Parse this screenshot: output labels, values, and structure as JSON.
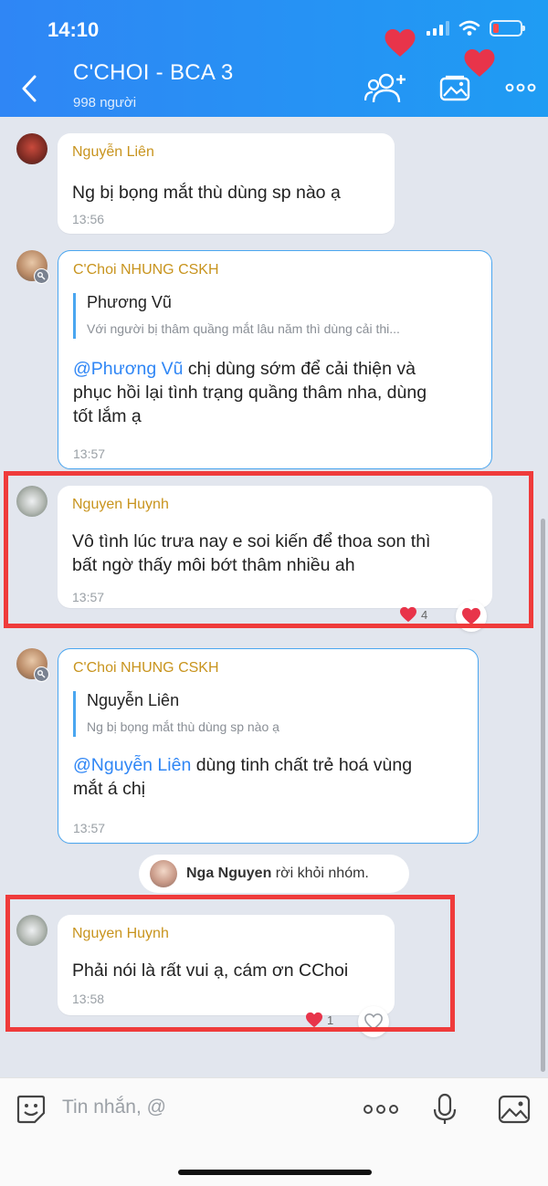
{
  "status": {
    "time": "14:10"
  },
  "header": {
    "title": "C'CHOI - BCA 3",
    "members": "998 người"
  },
  "colors": {
    "header": "#2f86f5",
    "sender": "#c8941e",
    "mention": "#2f86f5",
    "highlight": "#ef3b3b",
    "heart": "#e8344a"
  },
  "messages": [
    {
      "sender": "Nguyễn Liên",
      "text": "Ng bị bọng mắt thù dùng sp nào ạ",
      "time": "13:56"
    },
    {
      "sender": "C'Choi NHUNG CSKH",
      "quote": {
        "name": "Phương Vũ",
        "text": "Với người bị thâm quầng mắt lâu năm thì dùng cải thi..."
      },
      "mention": "@Phương Vũ",
      "text_line1": " chị dùng sớm để cải thiện và",
      "text_line2": "phục hồi lại tình trạng quầng thâm nha, dùng",
      "text_line3": "tốt lắm ạ",
      "time": "13:57"
    },
    {
      "sender": "Nguyen Huynh",
      "text_line1": "Vô tình lúc trưa nay e soi kiến để thoa son thì",
      "text_line2": "bất ngờ thấy môi bớt thâm nhiều ah",
      "time": "13:57",
      "reaction_count": "4"
    },
    {
      "sender": "C'Choi NHUNG CSKH",
      "quote": {
        "name": "Nguyễn Liên",
        "text": "Ng bị bọng mắt thù dùng sp nào ạ"
      },
      "mention": "@Nguyễn Liên",
      "text_line1": " dùng tinh chất trẻ hoá vùng",
      "text_line2": "mắt á chị",
      "time": "13:57"
    },
    {
      "sender": "Nguyen Huynh",
      "text": "Phải nói là rất vui ạ, cám ơn CChoi",
      "time": "13:58",
      "reaction_count": "1"
    }
  ],
  "system": {
    "name": "Nga Nguyen",
    "action": " rời khỏi nhóm."
  },
  "input": {
    "placeholder": "Tin nhắn, @"
  }
}
